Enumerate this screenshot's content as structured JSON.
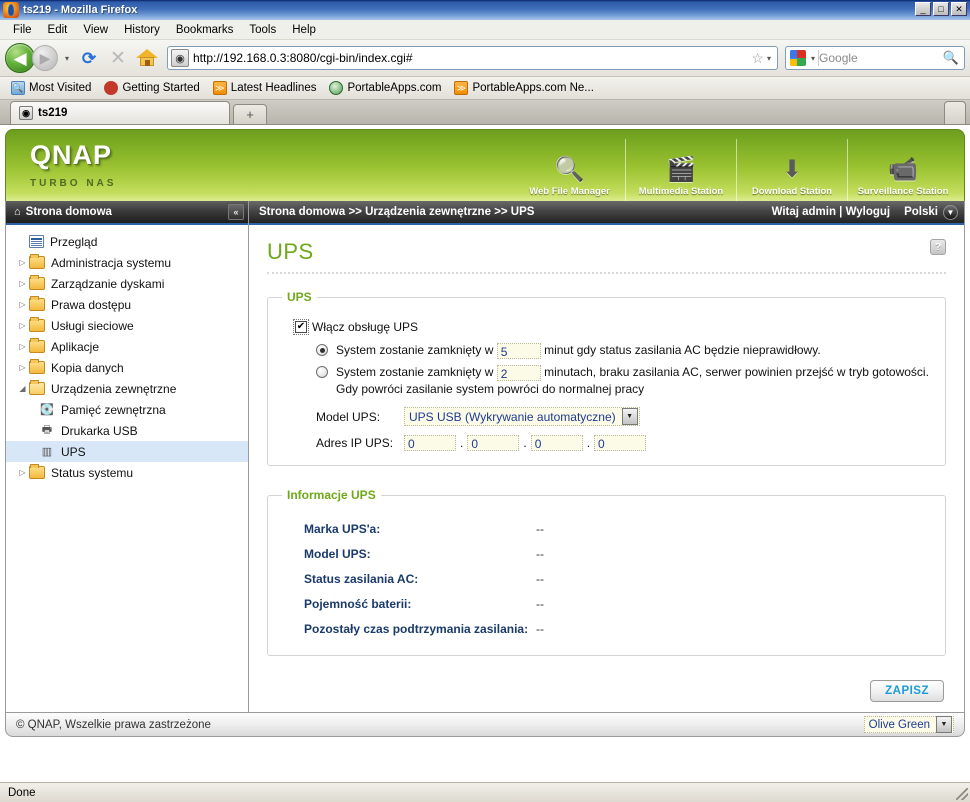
{
  "window": {
    "title": "ts219 - Mozilla Firefox",
    "icon": "firefox-icon",
    "minimize": "_",
    "maximize": "□",
    "close": "✕"
  },
  "menubar": {
    "items": [
      "File",
      "Edit",
      "View",
      "History",
      "Bookmarks",
      "Tools",
      "Help"
    ]
  },
  "navbar": {
    "back_icon": "◀",
    "forward_icon": "▶",
    "dropdown_icon": "▾",
    "reload_icon": "⟳",
    "stop_icon": "✕",
    "home_icon": "home-icon",
    "url": "http://192.168.0.3:8080/cgi-bin/index.cgi#",
    "url_favicon": "site-identity-icon",
    "star_icon": "☆",
    "caret_icon": "▾",
    "search_engine": "google-icon",
    "search_placeholder": "Google",
    "search_icon": "🔍"
  },
  "bookmarks": [
    {
      "label": "Most Visited",
      "icon": "most-visited-icon"
    },
    {
      "label": "Getting Started",
      "icon": "getting-started-icon"
    },
    {
      "label": "Latest Headlines",
      "icon": "rss-icon"
    },
    {
      "label": "PortableApps.com",
      "icon": "portableapps-icon"
    },
    {
      "label": "PortableApps.com Ne...",
      "icon": "rss-icon"
    }
  ],
  "tabs": {
    "active": "ts219",
    "favicon": "qnap-favicon",
    "new_tab_icon": "+"
  },
  "qnap": {
    "logo": "QNAP",
    "tagline": "TURBO NAS",
    "apps": [
      {
        "label": "Web File Manager",
        "icon": "folder-search-icon",
        "glyph": "🔍"
      },
      {
        "label": "Multimedia Station",
        "icon": "multimedia-icon",
        "glyph": "🎬"
      },
      {
        "label": "Download Station",
        "icon": "download-icon",
        "glyph": "⬇"
      },
      {
        "label": "Surveillance Station",
        "icon": "camera-icon",
        "glyph": "📹"
      }
    ]
  },
  "sidebar": {
    "header": "Strona domowa",
    "home_icon": "home-icon",
    "collapse_icon": "«",
    "items": [
      {
        "label": "Przegląd",
        "icon": "overview-icon",
        "type": "doc",
        "expandable": false,
        "selected": false,
        "child": false
      },
      {
        "label": "Administracja systemu",
        "icon": "folder-icon",
        "type": "folder",
        "expandable": true,
        "expanded": false,
        "selected": false,
        "child": false
      },
      {
        "label": "Zarządzanie dyskami",
        "icon": "folder-icon",
        "type": "folder",
        "expandable": true,
        "expanded": false,
        "selected": false,
        "child": false
      },
      {
        "label": "Prawa dostępu",
        "icon": "folder-icon",
        "type": "folder",
        "expandable": true,
        "expanded": false,
        "selected": false,
        "child": false
      },
      {
        "label": "Usługi sieciowe",
        "icon": "folder-icon",
        "type": "folder",
        "expandable": true,
        "expanded": false,
        "selected": false,
        "child": false
      },
      {
        "label": "Aplikacje",
        "icon": "folder-icon",
        "type": "folder",
        "expandable": true,
        "expanded": false,
        "selected": false,
        "child": false
      },
      {
        "label": "Kopia danych",
        "icon": "folder-icon",
        "type": "folder",
        "expandable": true,
        "expanded": false,
        "selected": false,
        "child": false
      },
      {
        "label": "Urządzenia zewnętrzne",
        "icon": "folder-open-icon",
        "type": "folder-open",
        "expandable": true,
        "expanded": true,
        "selected": false,
        "child": false
      },
      {
        "label": "Pamięć zewnętrzna",
        "icon": "external-storage-icon",
        "type": "misc",
        "glyph": "💾",
        "expandable": false,
        "selected": false,
        "child": true
      },
      {
        "label": "Drukarka USB",
        "icon": "printer-icon",
        "type": "misc",
        "glyph": "🖨",
        "expandable": false,
        "selected": false,
        "child": true
      },
      {
        "label": "UPS",
        "icon": "ups-icon",
        "type": "misc",
        "glyph": "🔋",
        "expandable": false,
        "selected": true,
        "child": true
      },
      {
        "label": "Status systemu",
        "icon": "folder-icon",
        "type": "folder",
        "expandable": true,
        "expanded": false,
        "selected": false,
        "child": false
      }
    ]
  },
  "topbar": {
    "breadcrumb": "Strona domowa >> Urządzenia zewnętrzne >> UPS",
    "welcome": "Witaj admin  |  Wyloguj",
    "language": "Polski",
    "language_caret_icon": "▼"
  },
  "main": {
    "page_title": "UPS",
    "help_icon": "?",
    "ups_section": {
      "legend": "UPS",
      "enable_label": "Włącz obsługę UPS",
      "enable_checked": true,
      "checkmark": "✔",
      "option1": {
        "selected": true,
        "prefix": "System zostanie zamknięty w",
        "value": "5",
        "suffix": "minut gdy status zasilania AC będzie nieprawidłowy."
      },
      "option2": {
        "selected": false,
        "prefix": "System zostanie zamknięty w",
        "value": "2",
        "suffix": "minutach, braku zasilania AC, serwer powinien przejść w tryb gotowości. Gdy powróci zasilanie system powróci do normalnej pracy"
      },
      "model_label": "Model UPS:",
      "model_value": "UPS USB (Wykrywanie automatyczne)",
      "model_caret_icon": "▼",
      "ip_label": "Adres IP UPS:",
      "ip_octets": [
        "0",
        "0",
        "0",
        "0"
      ],
      "ip_separator": "."
    },
    "info_section": {
      "legend": "Informacje UPS",
      "rows": [
        {
          "label": "Marka UPS'a:",
          "value": "--"
        },
        {
          "label": "Model UPS:",
          "value": "--"
        },
        {
          "label": "Status zasilania AC:",
          "value": "--"
        },
        {
          "label": "Pojemność baterii:",
          "value": "--"
        },
        {
          "label": "Pozostały czas podtrzymania zasilania:",
          "value": "--"
        }
      ]
    },
    "save_button": "ZAPISZ"
  },
  "footer": {
    "copyright": "© QNAP, Wszelkie prawa zastrzeżone",
    "theme": "Olive Green",
    "theme_caret_icon": "▼"
  },
  "statusbar": {
    "text": "Done"
  },
  "colors": {
    "accent_green": "#6fa81a",
    "header_green_top": "#6d9d1f",
    "header_green_bottom": "#dcec90",
    "link_blue": "#1b9bd8",
    "input_text": "#1f3a93",
    "selection_blue": "#d7e7f7"
  }
}
